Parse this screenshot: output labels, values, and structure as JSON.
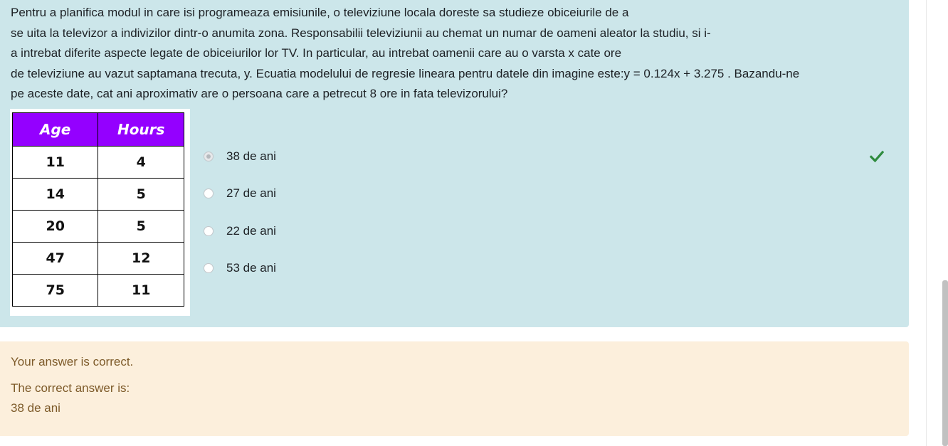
{
  "question": {
    "lines": [
      "Pentru a planifica modul in care isi programeaza emisiunile, o televiziune locala doreste sa studieze obiceiurile de a",
      "se uita la televizor a indivizilor dintr-o anumita zona. Responsabilii televiziunii au chemat un numar de oameni aleator la studiu, si i-",
      "a intrebat diferite aspecte legate de obiceiurilor lor TV. In particular, au intrebat oamenii care au o varsta x cate ore",
      "de televiziune au vazut saptamana trecuta, y. Ecuatia modelului de regresie lineara pentru datele din imagine este:y = 0.124x + 3.275 . Bazandu-ne",
      "pe aceste date, cat ani aproximativ are o persoana care a petrecut 8 ore in fata televizorului?"
    ]
  },
  "table": {
    "headers": [
      "Age",
      "Hours"
    ],
    "rows": [
      [
        "11",
        "4"
      ],
      [
        "14",
        "5"
      ],
      [
        "20",
        "5"
      ],
      [
        "47",
        "12"
      ],
      [
        "75",
        "11"
      ]
    ],
    "header_color": "#9400ff"
  },
  "answers": [
    {
      "label": "38 de ani",
      "selected": true,
      "correct": true
    },
    {
      "label": "27 de ani",
      "selected": false
    },
    {
      "label": "22 de ani",
      "selected": false
    },
    {
      "label": "53 de ani",
      "selected": false
    }
  ],
  "feedback": {
    "status": "Your answer is correct.",
    "correct_label": "The correct answer is:",
    "correct_value": "38 de ani"
  },
  "colors": {
    "question_bg": "#cce6ea",
    "feedback_bg": "#fcefdc",
    "feedback_text": "#7d5a29",
    "check": "#2e8b3e"
  },
  "icons": {
    "correct": "check-icon"
  }
}
